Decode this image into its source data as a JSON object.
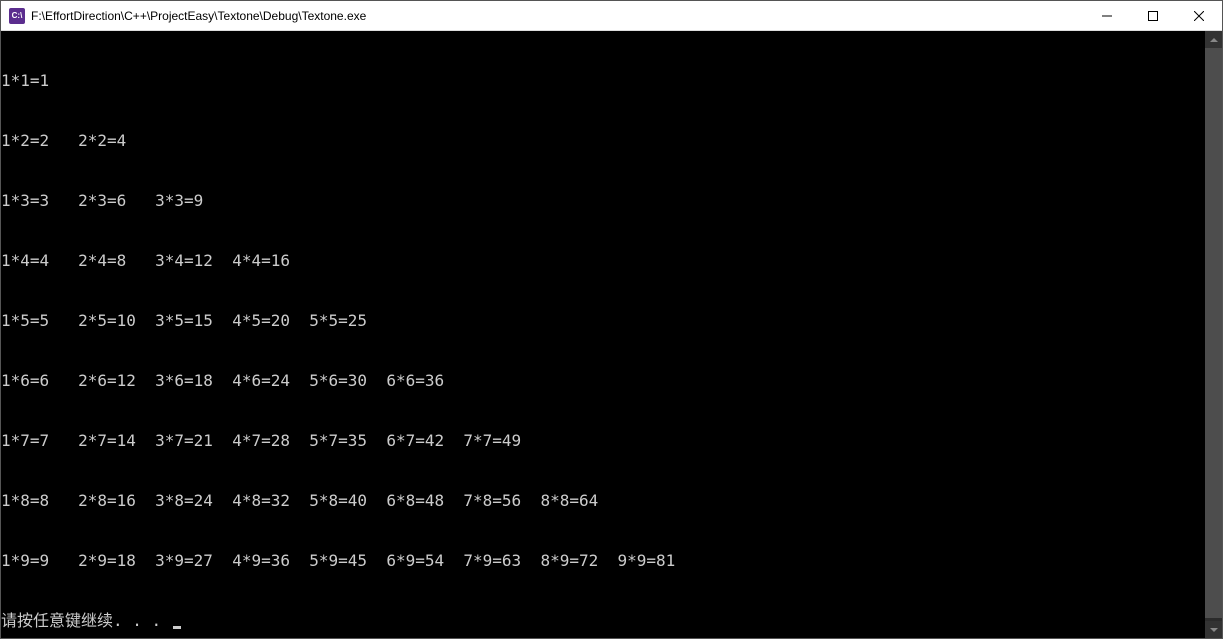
{
  "window": {
    "icon_text": "C:\\",
    "title": "F:\\EffortDirection\\C++\\ProjectEasy\\Textone\\Debug\\Textone.exe"
  },
  "console": {
    "lines": [
      "1*1=1",
      "1*2=2   2*2=4",
      "1*3=3   2*3=6   3*3=9",
      "1*4=4   2*4=8   3*4=12  4*4=16",
      "1*5=5   2*5=10  3*5=15  4*5=20  5*5=25",
      "1*6=6   2*6=12  3*6=18  4*6=24  5*6=30  6*6=36",
      "1*7=7   2*7=14  3*7=21  4*7=28  5*7=35  6*7=42  7*7=49",
      "1*8=8   2*8=16  3*8=24  4*8=32  5*8=40  6*8=48  7*8=56  8*8=64",
      "1*9=9   2*9=18  3*9=27  4*9=36  5*9=45  6*9=54  7*9=63  8*9=72  9*9=81"
    ],
    "prompt": "请按任意键继续. . . "
  }
}
